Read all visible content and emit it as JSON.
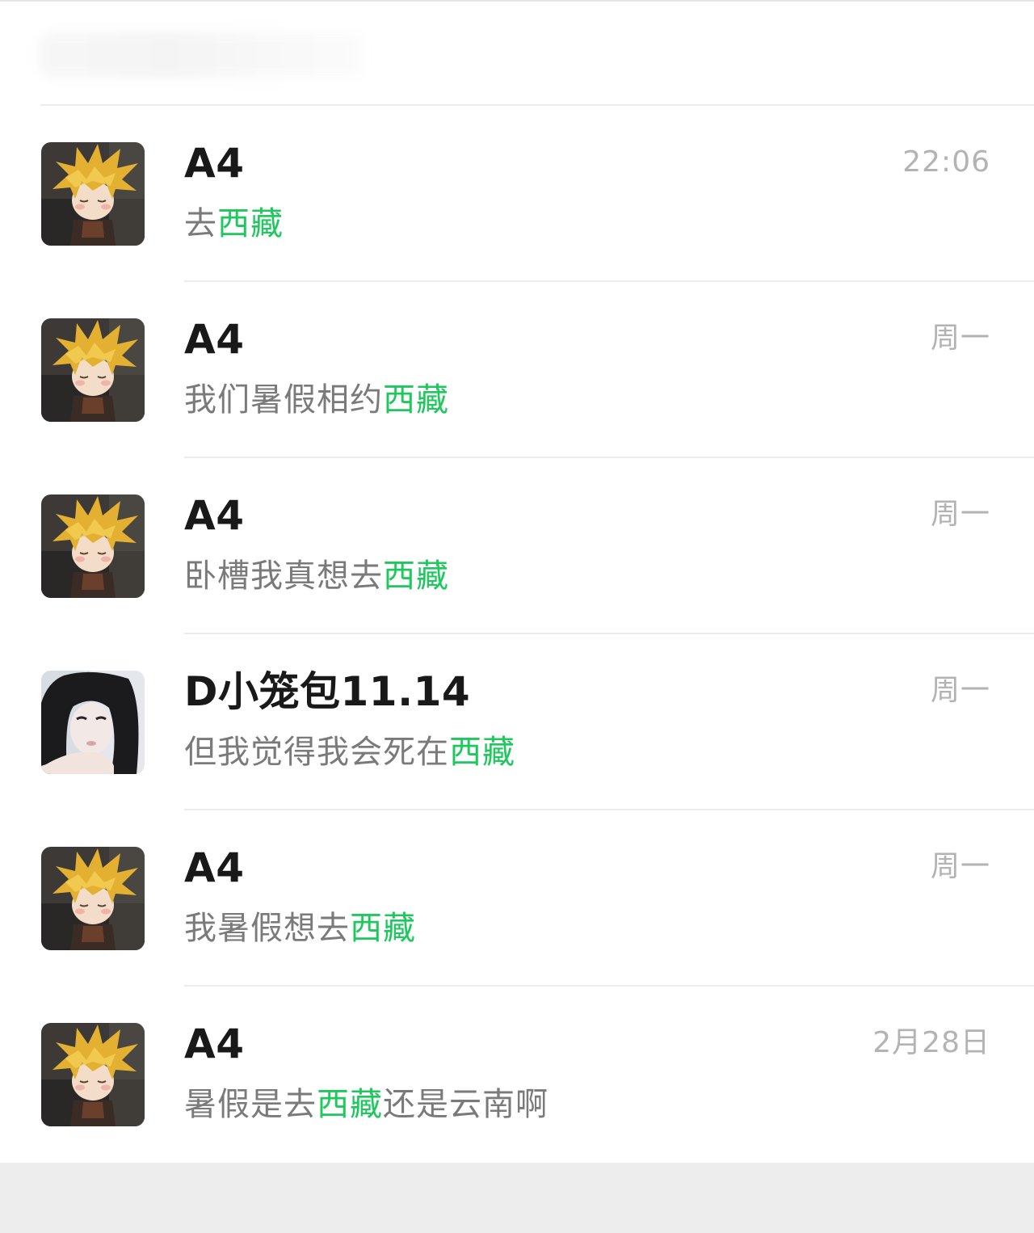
{
  "colors": {
    "highlight": "#1ec85c",
    "name_text": "#191919",
    "snippet_text": "#7a7a7a",
    "time_text": "#b3b3b3",
    "divider": "#ececec",
    "footer_bg": "#ededed"
  },
  "results": [
    {
      "name": "A4",
      "time": "22:06",
      "avatar": "cartoon-spiky-blonde-hair-character-icon",
      "snippet": {
        "before": "去",
        "highlight": "西藏",
        "after": ""
      }
    },
    {
      "name": "A4",
      "time": "周一",
      "avatar": "cartoon-spiky-blonde-hair-character-icon",
      "snippet": {
        "before": "我们暑假相约",
        "highlight": "西藏",
        "after": ""
      }
    },
    {
      "name": "A4",
      "time": "周一",
      "avatar": "cartoon-spiky-blonde-hair-character-icon",
      "snippet": {
        "before": "卧槽我真想去",
        "highlight": "西藏",
        "after": ""
      }
    },
    {
      "name": "D小笼包11.14",
      "time": "周一",
      "avatar": "girl-selfie-photo-icon",
      "snippet": {
        "before": "但我觉得我会死在",
        "highlight": "西藏",
        "after": ""
      }
    },
    {
      "name": "A4",
      "time": "周一",
      "avatar": "cartoon-spiky-blonde-hair-character-icon",
      "snippet": {
        "before": "我暑假想去",
        "highlight": "西藏",
        "after": ""
      }
    },
    {
      "name": "A4",
      "time": "2月28日",
      "avatar": "cartoon-spiky-blonde-hair-character-icon",
      "snippet": {
        "before": "暑假是去",
        "highlight": "西藏",
        "after": "还是云南啊"
      }
    }
  ]
}
